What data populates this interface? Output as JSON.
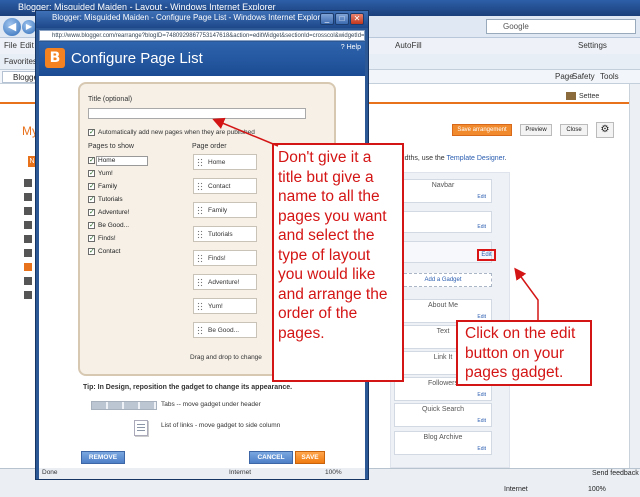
{
  "background_window": {
    "title": "Blogger: Misguided Maiden - Layout - Windows Internet Explorer",
    "search_placeholder": "Google",
    "menu": {
      "file": "File",
      "edit": "Edit",
      "favorites": "Favorites"
    },
    "toolbar": {
      "autofill": "AutoFill",
      "settings": "Settings"
    },
    "tab_label": "Blogger: P",
    "commands": {
      "page": "Page",
      "safety": "Safety",
      "tools": "Tools"
    },
    "blogger": {
      "my": "My",
      "ne_badge": "Ne",
      "save_arrangement": "Save arrangement",
      "preview": "Preview",
      "close": "Close",
      "user": "Settee",
      "widths_note_prefix": "widths, use the",
      "template_designer": "Template Designer",
      "add_gadget": "Add a Gadget",
      "edit": "Edit",
      "gadgets": [
        {
          "name": "Navbar"
        },
        {
          "name": ""
        },
        {
          "name": ""
        },
        {
          "name": "About Me"
        },
        {
          "name": "Text"
        },
        {
          "name": "Link It"
        },
        {
          "name": "Followers"
        },
        {
          "name": "Quick Search"
        },
        {
          "name": "Blog Archive"
        }
      ]
    },
    "status": {
      "internet": "Internet",
      "zoom": "100%",
      "send_feedback": "Send feedback"
    }
  },
  "popup": {
    "window_title": "Blogger: Misguided Maiden - Configure Page List - Windows Internet Explorer",
    "url": "http://www.blogger.com/rearrange?blogID=7480929867753147618&action=editWidget&sectionId=crosscol&widgetId=PageList1",
    "heading": "Configure Page List",
    "help": "? Help",
    "title_label": "Title (optional)",
    "title_value": "",
    "auto_add_label": "Automatically add new pages when they are published",
    "pages_to_show_header": "Pages to show",
    "page_order_header": "Page order",
    "pages_to_show": [
      "Home",
      "Yum!",
      "Family",
      "Tutorials",
      "Adventure!",
      "Be Good...",
      "Finds!",
      "Contact"
    ],
    "page_order": [
      "Home",
      "Contact",
      "Family",
      "Tutorials",
      "Finds!",
      "Adventure!",
      "Yum!",
      "Be Good..."
    ],
    "drag_note": "Drag and drop to change",
    "tip_bold": "Tip: In Design, reposition the gadget to change its appearance.",
    "tabs_desc": "Tabs -- move gadget under header",
    "list_desc": "List of links - move gadget to side column",
    "remove": "REMOVE",
    "cancel": "CANCEL",
    "save": "SAVE",
    "status": {
      "done": "Done",
      "internet": "Internet",
      "zoom": "100%"
    }
  },
  "annotations": {
    "callout1": "Don't give it a title but give a name to all the pages you want and select the type of layout you would like and arrange the order of the pages.",
    "callout2": "Click on the edit button on your pages gadget.",
    "color": "#d41515"
  }
}
